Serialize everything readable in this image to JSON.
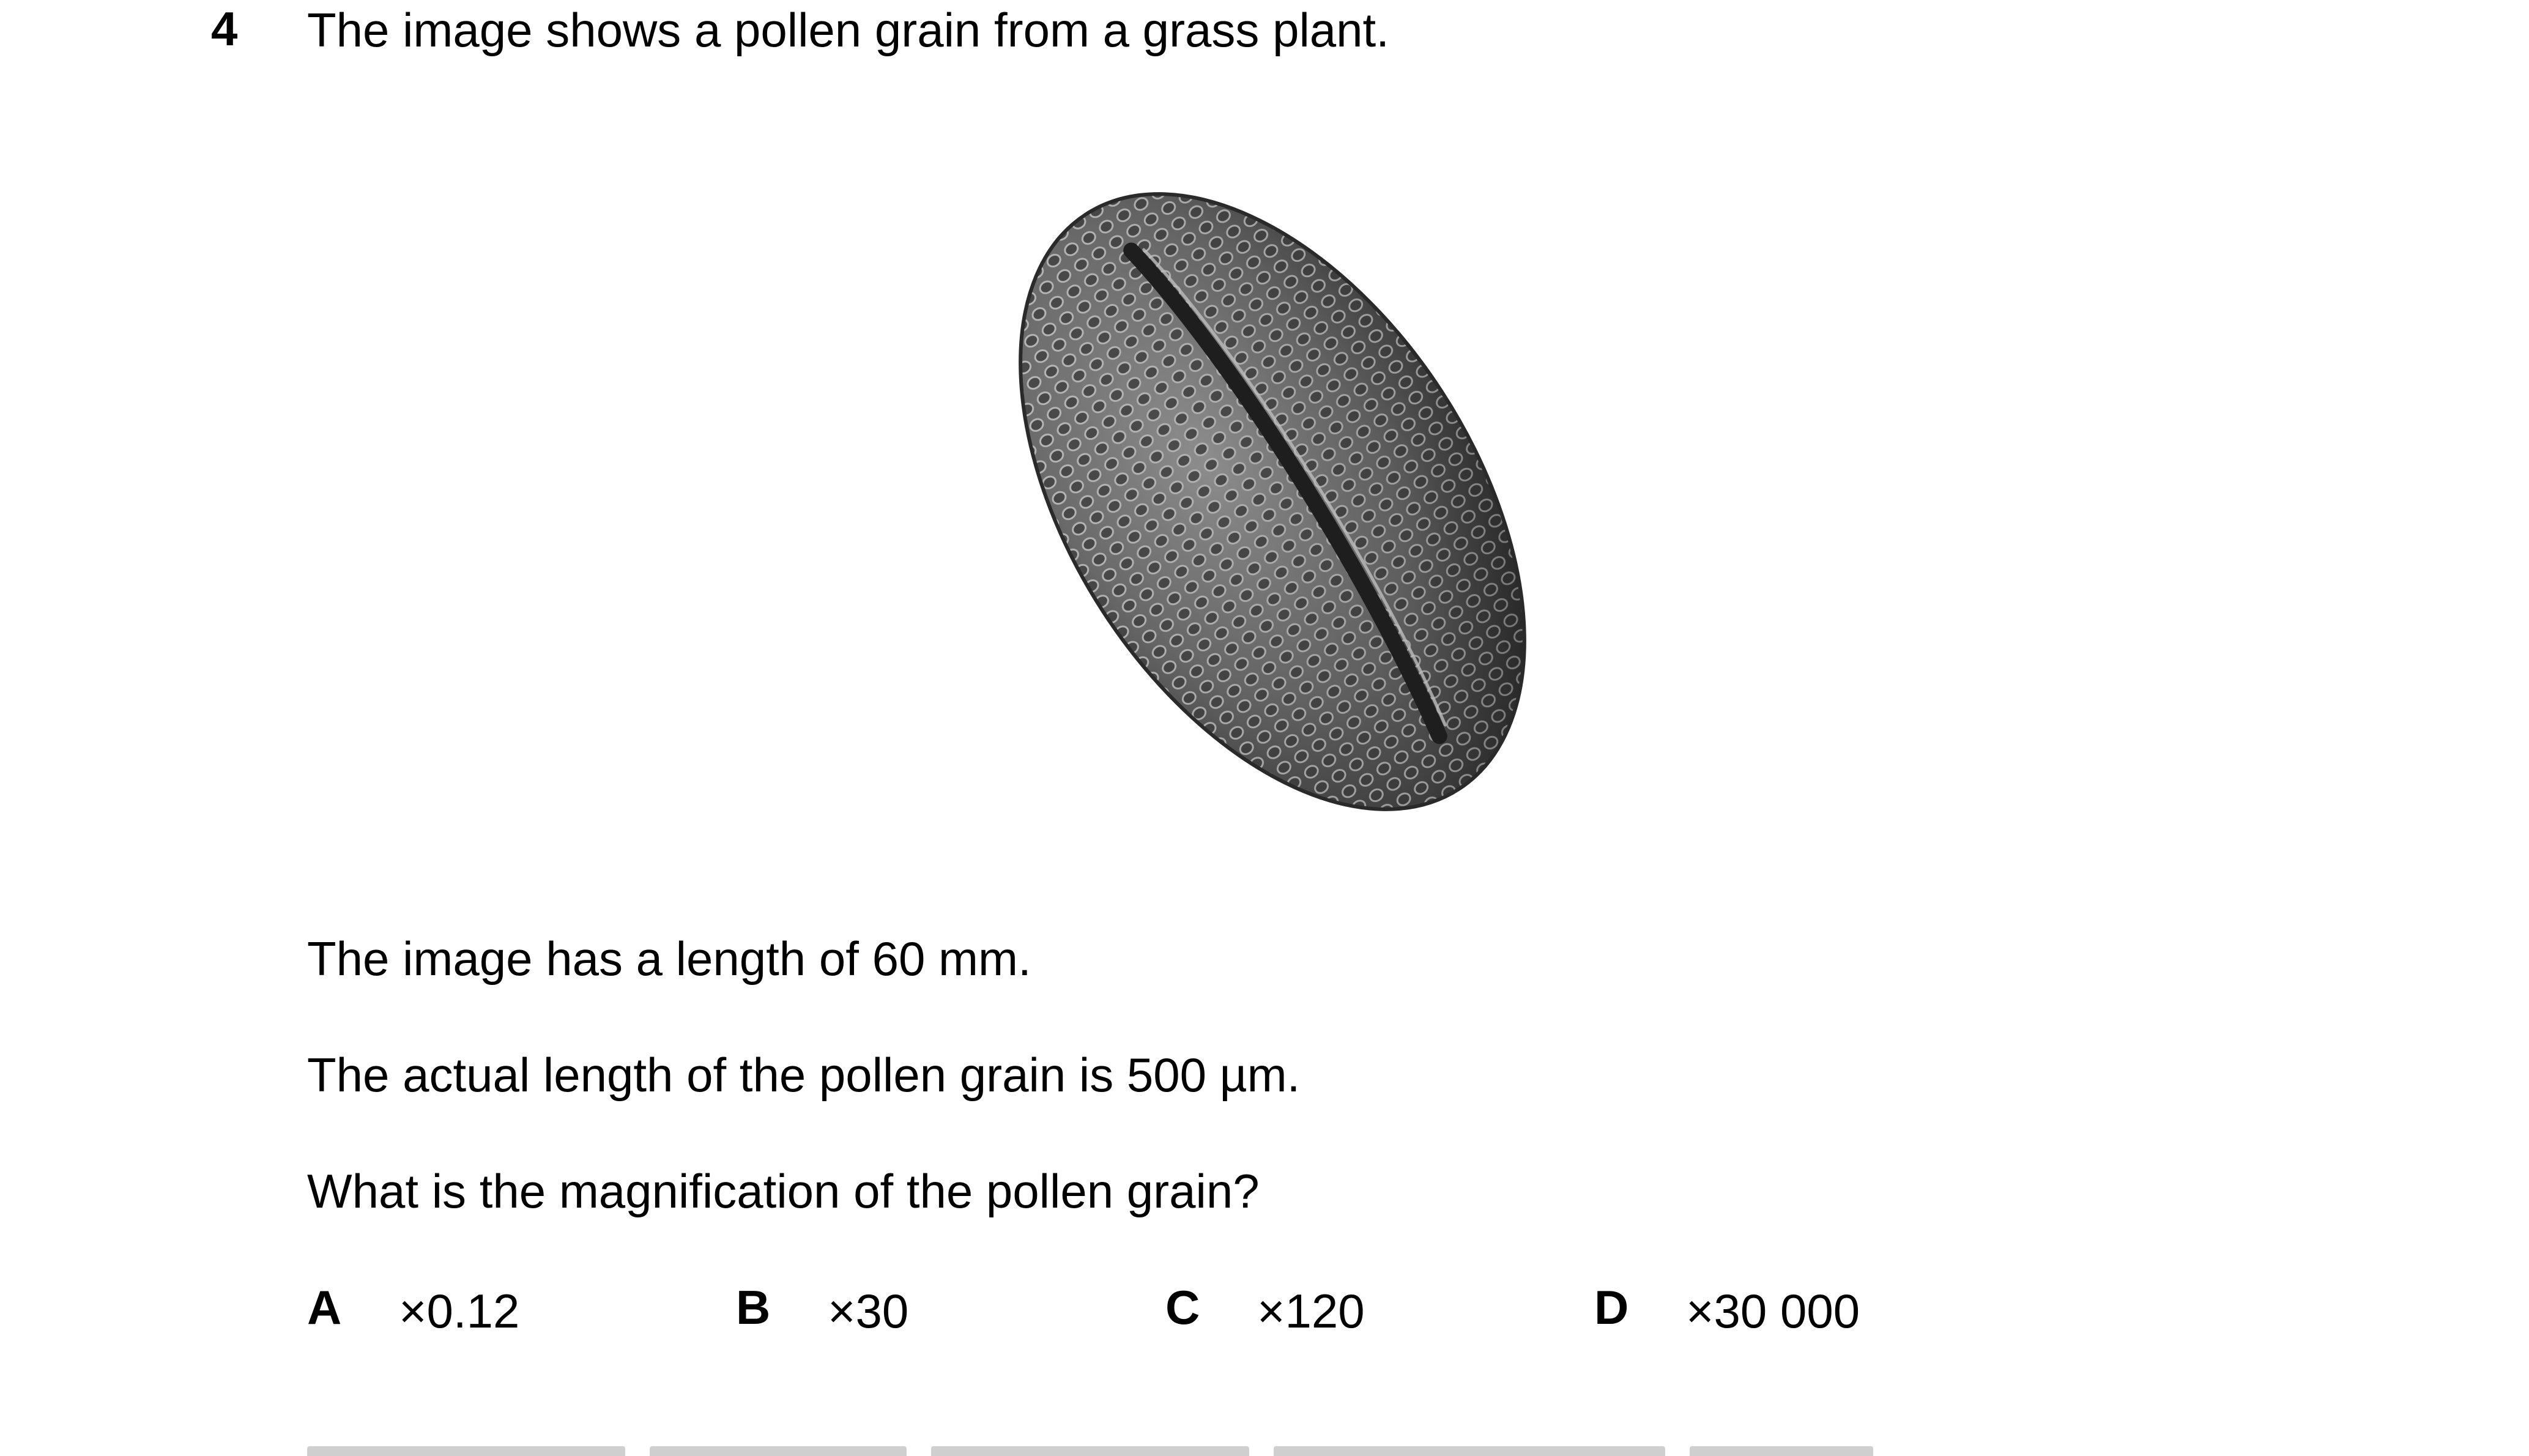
{
  "question": {
    "number": "4",
    "stem": "The image shows a pollen grain from a grass plant.",
    "image_length": "The image has a length of 60 mm.",
    "actual_length": "The actual length of the pollen grain is 500 µm.",
    "prompt": "What is the magnification of the pollen grain?"
  },
  "options": [
    {
      "letter": "A",
      "value": "×0.12"
    },
    {
      "letter": "B",
      "value": "×30"
    },
    {
      "letter": "C",
      "value": "×120"
    },
    {
      "letter": "D",
      "value": "×30 000"
    }
  ],
  "figure": {
    "subject": "pollen-grain-micrograph"
  }
}
